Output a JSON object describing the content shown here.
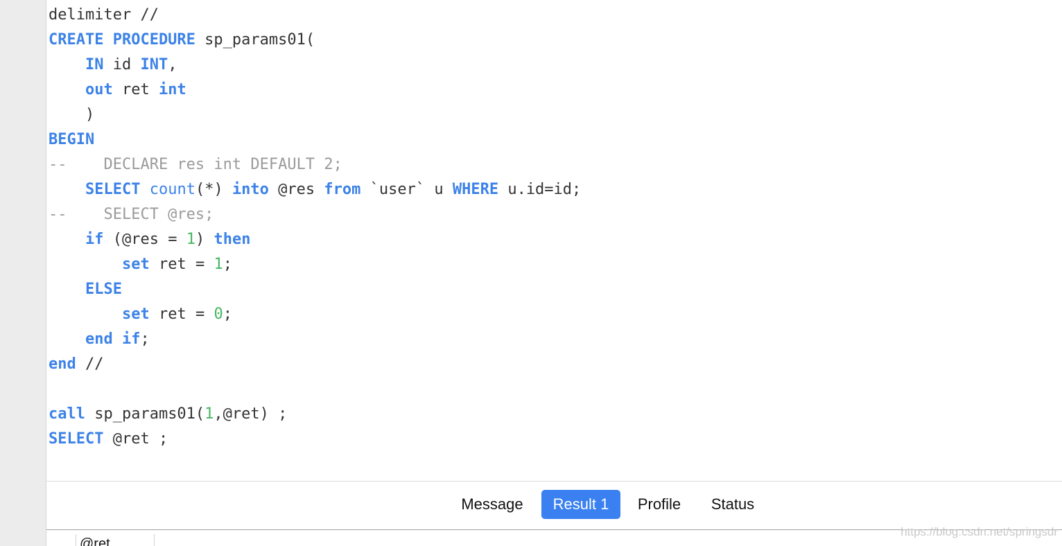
{
  "editor": {
    "lines": [
      [
        {
          "t": "delimiter //",
          "c": "plain"
        }
      ],
      [
        {
          "t": "CREATE PROCEDURE",
          "c": "kw"
        },
        {
          "t": " sp_params01(",
          "c": "plain"
        }
      ],
      [
        {
          "t": "    ",
          "c": "plain"
        },
        {
          "t": "IN",
          "c": "kw"
        },
        {
          "t": " id ",
          "c": "plain"
        },
        {
          "t": "INT",
          "c": "kw"
        },
        {
          "t": ",",
          "c": "plain"
        }
      ],
      [
        {
          "t": "    ",
          "c": "plain"
        },
        {
          "t": "out",
          "c": "kw"
        },
        {
          "t": " ret ",
          "c": "plain"
        },
        {
          "t": "int",
          "c": "kw"
        }
      ],
      [
        {
          "t": "    )",
          "c": "plain"
        }
      ],
      [
        {
          "t": "BEGIN",
          "c": "kw"
        }
      ],
      [
        {
          "t": "--    DECLARE res int DEFAULT 2;",
          "c": "comment"
        }
      ],
      [
        {
          "t": "    ",
          "c": "plain"
        },
        {
          "t": "SELECT",
          "c": "kw"
        },
        {
          "t": " ",
          "c": "plain"
        },
        {
          "t": "count",
          "c": "fn"
        },
        {
          "t": "(*) ",
          "c": "plain"
        },
        {
          "t": "into",
          "c": "kw"
        },
        {
          "t": " @res ",
          "c": "plain"
        },
        {
          "t": "from",
          "c": "kw"
        },
        {
          "t": " `user` u ",
          "c": "plain"
        },
        {
          "t": "WHERE",
          "c": "kw"
        },
        {
          "t": " u.id=id;",
          "c": "plain"
        }
      ],
      [
        {
          "t": "--    SELECT @res;",
          "c": "comment"
        }
      ],
      [
        {
          "t": "    ",
          "c": "plain"
        },
        {
          "t": "if",
          "c": "kw"
        },
        {
          "t": " (@res = ",
          "c": "plain"
        },
        {
          "t": "1",
          "c": "num"
        },
        {
          "t": ") ",
          "c": "plain"
        },
        {
          "t": "then",
          "c": "kw"
        }
      ],
      [
        {
          "t": "        ",
          "c": "plain"
        },
        {
          "t": "set",
          "c": "kw"
        },
        {
          "t": " ret = ",
          "c": "plain"
        },
        {
          "t": "1",
          "c": "num"
        },
        {
          "t": ";",
          "c": "plain"
        }
      ],
      [
        {
          "t": "    ",
          "c": "plain"
        },
        {
          "t": "ELSE",
          "c": "kw"
        }
      ],
      [
        {
          "t": "        ",
          "c": "plain"
        },
        {
          "t": "set",
          "c": "kw"
        },
        {
          "t": " ret = ",
          "c": "plain"
        },
        {
          "t": "0",
          "c": "num"
        },
        {
          "t": ";",
          "c": "plain"
        }
      ],
      [
        {
          "t": "    ",
          "c": "plain"
        },
        {
          "t": "end",
          "c": "kw"
        },
        {
          "t": " ",
          "c": "plain"
        },
        {
          "t": "if",
          "c": "kw"
        },
        {
          "t": ";",
          "c": "plain"
        }
      ],
      [
        {
          "t": "end",
          "c": "kw"
        },
        {
          "t": " //",
          "c": "plain"
        }
      ],
      [],
      [
        {
          "t": "call",
          "c": "kw"
        },
        {
          "t": " sp_params01(",
          "c": "plain"
        },
        {
          "t": "1",
          "c": "num"
        },
        {
          "t": ",@ret) ;",
          "c": "plain"
        }
      ],
      [
        {
          "t": "SELECT",
          "c": "kw"
        },
        {
          "t": " @ret ;",
          "c": "plain"
        }
      ]
    ]
  },
  "tabs": {
    "message": "Message",
    "result1": "Result 1",
    "profile": "Profile",
    "status": "Status",
    "active": "result1"
  },
  "results": {
    "column_header": "@ret"
  },
  "watermark": "https://blog.csdn.net/springsdr",
  "colors": {
    "keyword": "#3c82e8",
    "number": "#45b75f",
    "comment": "#9a9a9a",
    "active_tab": "#3a80f0"
  }
}
